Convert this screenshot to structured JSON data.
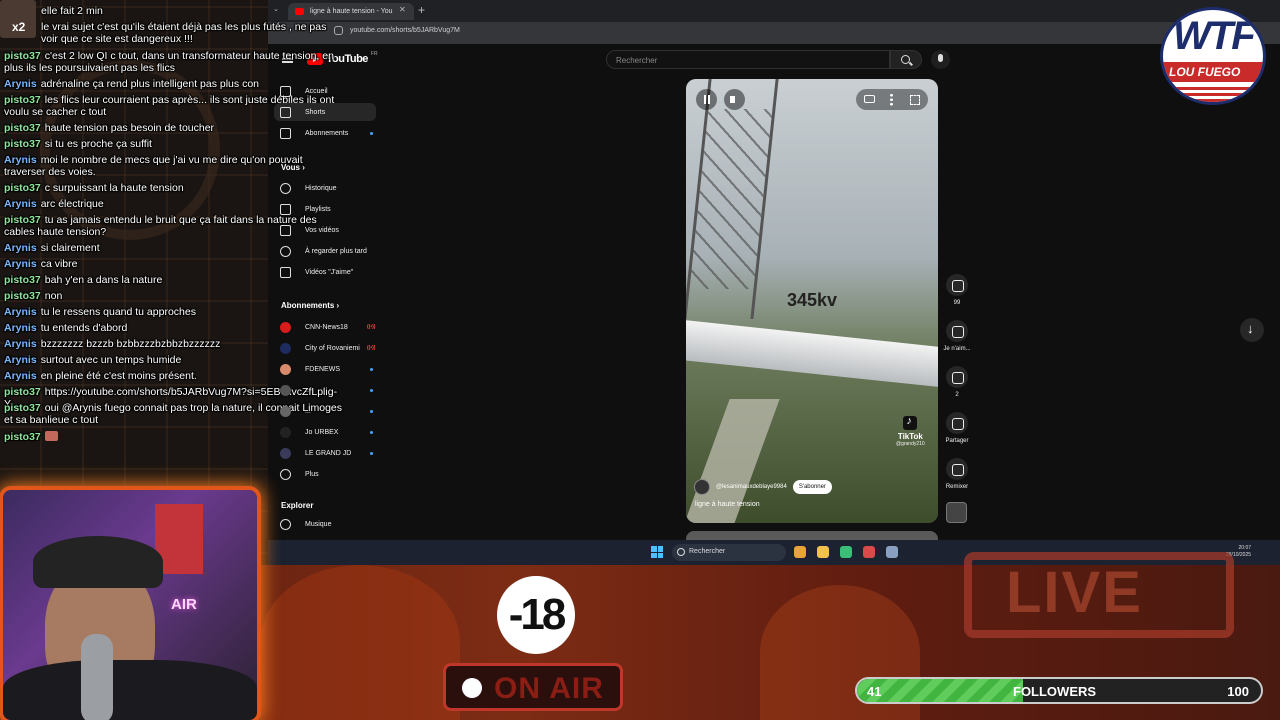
{
  "browser": {
    "tab_title": "ligne à haute tension - You",
    "new_tab": "+",
    "url": "youtube.com/shorts/b5JARbVug7M"
  },
  "youtube": {
    "logo": "YouTube",
    "region": "FR",
    "search_placeholder": "Rechercher",
    "sidebar": {
      "main": [
        {
          "label": "Accueil"
        },
        {
          "label": "Shorts"
        },
        {
          "label": "Abonnements"
        }
      ],
      "you_heading": "Vous",
      "you_items": [
        {
          "label": "Historique"
        },
        {
          "label": "Playlists"
        },
        {
          "label": "Vos vidéos"
        },
        {
          "label": "À regarder plus tard"
        },
        {
          "label": "Vidéos \"J'aime\""
        }
      ],
      "subs_heading": "Abonnements",
      "subs": [
        {
          "label": "CNN-News18",
          "avatar_color": "#d81b1b"
        },
        {
          "label": "City of Rovaniemi",
          "avatar_color": "#1d2b5e"
        },
        {
          "label": "FDENEWS",
          "avatar_color": "#d88a6c"
        },
        {
          "label": "...",
          "avatar_color": "#555555"
        },
        {
          "label": "...",
          "avatar_color": "#666666"
        },
        {
          "label": "Jo URBEX",
          "avatar_color": "#222222"
        },
        {
          "label": "LE GRAND JD",
          "avatar_color": "#3a3a5a"
        }
      ],
      "more": "Plus",
      "explore_heading": "Explorer",
      "explore_items": [
        {
          "label": "Musique"
        }
      ]
    },
    "short": {
      "overlay_text": "345kv",
      "tiktok_brand": "TikTok",
      "tiktok_handle": "@grandy210",
      "channel": "@lesanimauxdeblaye9984",
      "subscribe": "S'abonner",
      "title": "ligne à haute tension"
    },
    "actions": [
      {
        "name": "like",
        "label": "99"
      },
      {
        "name": "dislike",
        "label": "Je n'aim..."
      },
      {
        "name": "comments",
        "label": "2"
      },
      {
        "name": "share",
        "label": "Partager"
      },
      {
        "name": "remix",
        "label": "Remixer"
      }
    ]
  },
  "taskbar": {
    "search": "Rechercher",
    "time": "20:07",
    "date": "28/10/2025",
    "apps": [
      {
        "name": "chrome",
        "color": "#e8a33a"
      },
      {
        "name": "explorer",
        "color": "#f3c04e"
      },
      {
        "name": "app-green",
        "color": "#3bbf78"
      },
      {
        "name": "app-red",
        "color": "#d94a4a"
      },
      {
        "name": "settings",
        "color": "#8aa0c0"
      }
    ]
  },
  "overlay": {
    "age_badge": "-18",
    "on_air": "ON AIR",
    "live_sign": "LIVE",
    "logo_main": "WTF",
    "logo_sub": "LOU FUEGO",
    "followers": {
      "current": "41",
      "label": "FOLLOWERS",
      "goal": "100",
      "fraction": 0.41
    },
    "webcam_neon": "AIR"
  },
  "chat": [
    {
      "user": "",
      "text": "elle fait 2 min"
    },
    {
      "user": "",
      "text": "le vrai sujet c'est qu'ils étaient déjà pas les plus futés , ne pas voir que ce site est dangereux !!!"
    },
    {
      "user": "pisto37",
      "text": "c'est 2 low QI c tout, dans un transformateur haute tension, en plus ils les poursuivaient pas les flics"
    },
    {
      "user": "Arynis",
      "text": "adrénaline ça rend plus intelligent pas plus con"
    },
    {
      "user": "pisto37",
      "text": "les flics leur courraient pas après... ils sont juste débiles ils ont voulu se cacher c tout"
    },
    {
      "user": "pisto37",
      "text": "haute tension pas besoin de toucher"
    },
    {
      "user": "pisto37",
      "text": "si tu es proche ça suffit"
    },
    {
      "user": "Arynis",
      "text": "moi le nombre de mecs que j'ai vu me dire qu'on pouvait traverser des voies."
    },
    {
      "user": "pisto37",
      "text": "c surpuissant la haute tension"
    },
    {
      "user": "Arynis",
      "text": "arc électrique"
    },
    {
      "user": "pisto37",
      "text": "tu as jamais entendu le bruit que ça fait dans la nature des cables haute tension?"
    },
    {
      "user": "Arynis",
      "text": "si clairement"
    },
    {
      "user": "Arynis",
      "text": "ca vibre"
    },
    {
      "user": "pisto37",
      "text": "bah y'en a dans la nature"
    },
    {
      "user": "pisto37",
      "text": "non"
    },
    {
      "user": "Arynis",
      "text": "tu le ressens quand tu approches"
    },
    {
      "user": "Arynis",
      "text": "tu entends d'abord"
    },
    {
      "user": "Arynis",
      "text": "bzzzzzzz bzzzb bzbbzzzbzbbzbzzzzzz"
    },
    {
      "user": "Arynis",
      "text": "surtout avec un temps humide"
    },
    {
      "user": "Arynis",
      "text": "en pleine été c'est moins présent."
    },
    {
      "user": "pisto37",
      "text": "https://youtube.com/shorts/b5JARbVug7M?si=5EB6kvcZfLplig-Y"
    },
    {
      "user": "pisto37",
      "text": "oui @Arynis fuego connait pas trop la nature, il connait Limoges et sa banlieue c tout"
    },
    {
      "user": "pisto37",
      "text": ""
    }
  ]
}
